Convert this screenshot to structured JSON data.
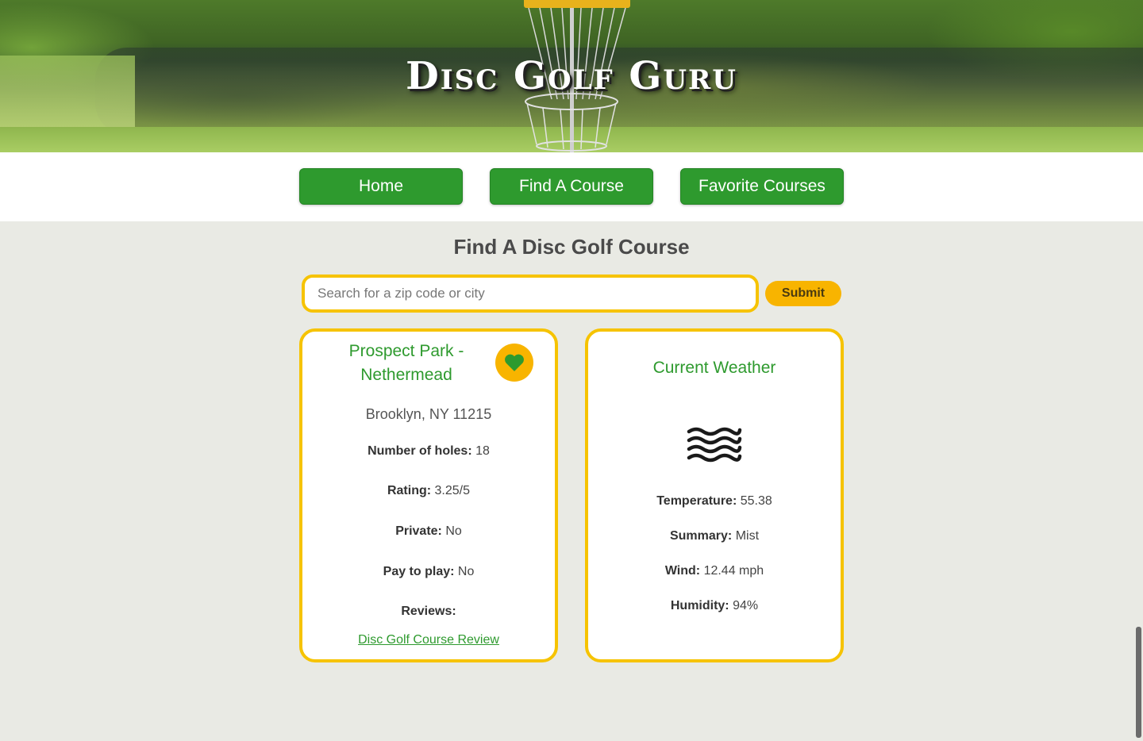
{
  "header": {
    "title": "Disc Golf Guru"
  },
  "nav": {
    "home": "Home",
    "find_course": "Find A Course",
    "favorites": "Favorite Courses"
  },
  "main": {
    "heading": "Find A Disc Golf Course",
    "search_placeholder": "Search for a zip code or city",
    "search_value": "",
    "submit_label": "Submit"
  },
  "course": {
    "name": "Prospect Park - Nethermead",
    "address": "Brooklyn, NY 11215",
    "holes_label": "Number of holes:",
    "holes": "18",
    "rating_label": "Rating:",
    "rating": "3.25/5",
    "private_label": "Private:",
    "private": "No",
    "pay_label": "Pay to play:",
    "pay": "No",
    "reviews_label": "Reviews:",
    "review_link": "Disc Golf Course Review",
    "favorite_icon": "heart-icon"
  },
  "weather": {
    "title": "Current Weather",
    "icon": "mist-icon",
    "temp_label": "Temperature:",
    "temp": "55.38",
    "summary_label": "Summary:",
    "summary": "Mist",
    "wind_label": "Wind:",
    "wind": "12.44 mph",
    "humidity_label": "Humidity:",
    "humidity": "94%"
  },
  "colors": {
    "primary_green": "#2e9a2e",
    "accent_yellow": "#f8b400",
    "card_border": "#f6c300",
    "background": "#e9eae4"
  }
}
